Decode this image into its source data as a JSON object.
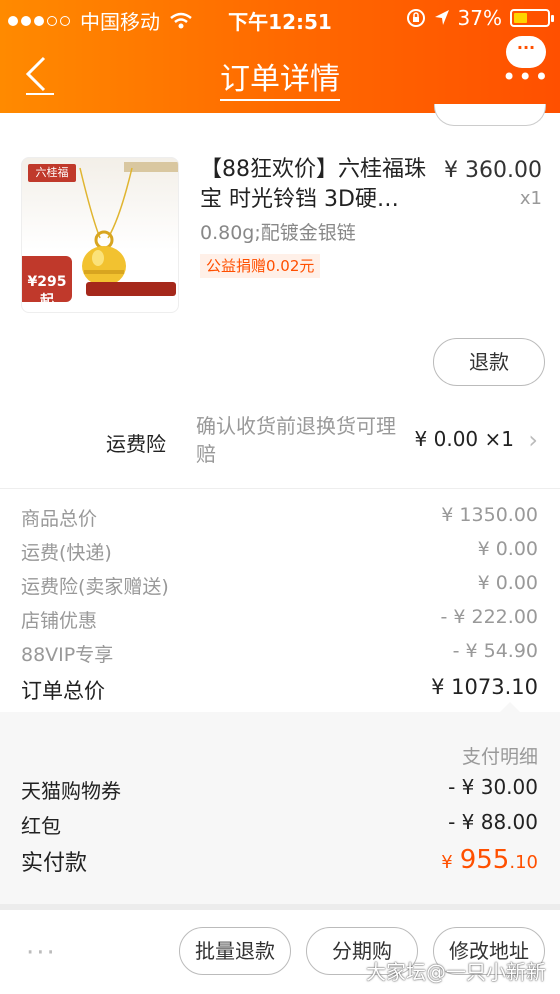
{
  "status_bar": {
    "carrier": "中国移动",
    "time": "下午12:51",
    "battery": "37%"
  },
  "nav": {
    "title": "订单详情",
    "more_badge": "···"
  },
  "product": {
    "title": "【88狂欢价】六桂福珠宝 时光铃铛 3D硬…",
    "price": "¥ 360.00",
    "quantity": "x1",
    "sku": "0.80g;配镀金银链",
    "charity": "公益捐赠0.02元",
    "image": {
      "brand": "六桂福",
      "price_tag": "¥295起"
    },
    "refund_button": "退款"
  },
  "insurance": {
    "label": "运费险",
    "description": "确认收货前退换货可理赔",
    "value": "¥ 0.00 ×1"
  },
  "summary": {
    "rows": [
      {
        "label": "商品总价",
        "value": "¥ 1350.00"
      },
      {
        "label": "运费(快递)",
        "value": "¥ 0.00"
      },
      {
        "label": "运费险(卖家赠送)",
        "value": "¥ 0.00"
      },
      {
        "label": "店铺优惠",
        "value": "- ¥ 222.00"
      },
      {
        "label": "88VIP专享",
        "value": "- ¥ 54.90"
      }
    ],
    "total_label": "订单总价",
    "total_value": "¥ 1073.10"
  },
  "payment": {
    "header": "支付明细",
    "rows": [
      {
        "label": "天猫购物券",
        "value": "- ¥ 30.00"
      },
      {
        "label": "红包",
        "value": "- ¥ 88.00"
      }
    ],
    "actual_label": "实付款",
    "actual_currency": "¥",
    "actual_int": "955",
    "actual_dec": ".10"
  },
  "bottom_bar": {
    "more": "···",
    "buttons": [
      "批量退款",
      "分期购",
      "修改地址"
    ]
  },
  "watermark": "大家坛@一只小新新",
  "colors": {
    "accent": "#ff5000",
    "header_start": "#ff8a00"
  }
}
